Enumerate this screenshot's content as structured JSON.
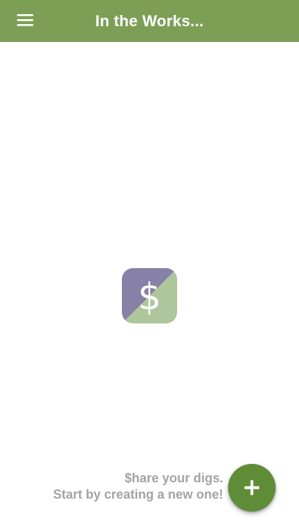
{
  "header": {
    "title": "In the Works...",
    "menu_icon": "hamburger-menu-icon"
  },
  "logo": {
    "icon": "dollar-sign-logo-icon",
    "glyph": "$",
    "colors": {
      "purple": "#8780a7",
      "green": "#aec69b"
    }
  },
  "empty_state": {
    "line1": "$hare your digs.",
    "line2": "Start by creating a new one!"
  },
  "fab": {
    "icon": "plus-icon"
  },
  "colors": {
    "app_bar": "#7c9f55",
    "fab": "#5f8d37",
    "hint_text": "#a3a3a3"
  }
}
